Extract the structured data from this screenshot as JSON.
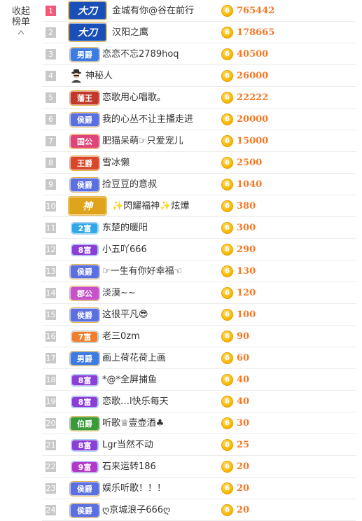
{
  "collapse": {
    "line1": "收起",
    "line2": "榜单"
  },
  "rows": [
    {
      "rank": "1",
      "badge": "大刀",
      "name": "金城有你@谷在前行",
      "score": "765442",
      "bg": "#1a4fb8",
      "kind": "big"
    },
    {
      "rank": "2",
      "badge": "大刀",
      "name": "汉阳之鹰",
      "score": "178665",
      "bg": "#1a4fb8",
      "kind": "big"
    },
    {
      "rank": "3",
      "badge": "男爵",
      "name": "恋恋不忘2789hoq",
      "score": "40500",
      "bg": "#3d7be0",
      "kind": "norm"
    },
    {
      "rank": "4",
      "badge": "",
      "name": "神秘人",
      "score": "26000",
      "bg": "",
      "kind": "spy"
    },
    {
      "rank": "5",
      "badge": "藩王",
      "name": "恋歌用心唱歌。",
      "score": "22222",
      "bg": "#c0392b",
      "kind": "norm"
    },
    {
      "rank": "6",
      "badge": "侯爵",
      "name": "我的心丛不让主播走进",
      "score": "20000",
      "bg": "#5b6fe0",
      "kind": "norm"
    },
    {
      "rank": "7",
      "badge": "国公",
      "name": "肥猫呆萌☞只爱宠儿",
      "score": "15000",
      "bg": "#e0457a",
      "kind": "norm"
    },
    {
      "rank": "8",
      "badge": "王爵",
      "name": "雪冰懒",
      "score": "2500",
      "bg": "#d9462b",
      "kind": "norm"
    },
    {
      "rank": "9",
      "badge": "侯爵",
      "name": "捡豆豆的意叔",
      "score": "1040",
      "bg": "#5b6fe0",
      "kind": "norm"
    },
    {
      "rank": "10",
      "badge": "神",
      "name": "✨閃耀福神✨炫燁",
      "score": "380",
      "bg": "#e0a41c",
      "kind": "big"
    },
    {
      "rank": "11",
      "badge": "2富",
      "name": "东楚的暖阳",
      "score": "300",
      "bg": "#33a6e6",
      "kind": "sm"
    },
    {
      "rank": "12",
      "badge": "8富",
      "name": "小五吖666",
      "score": "290",
      "bg": "#8a3fd6",
      "kind": "sm"
    },
    {
      "rank": "13",
      "badge": "侯爵",
      "name": "☞一生有你好幸福☜",
      "score": "130",
      "bg": "#5b6fe0",
      "kind": "norm"
    },
    {
      "rank": "14",
      "badge": "郡公",
      "name": "淡漠~~",
      "score": "120",
      "bg": "#c552c9",
      "kind": "norm"
    },
    {
      "rank": "15",
      "badge": "侯爵",
      "name": "这很平凡😎",
      "score": "100",
      "bg": "#5b6fe0",
      "kind": "norm"
    },
    {
      "rank": "16",
      "badge": "7富",
      "name": "老三0zm",
      "score": "90",
      "bg": "#ef7d2b",
      "kind": "sm"
    },
    {
      "rank": "17",
      "badge": "男爵",
      "name": "画上荷花荷上画",
      "score": "60",
      "bg": "#3d7be0",
      "kind": "norm"
    },
    {
      "rank": "18",
      "badge": "8富",
      "name": "*@*全屏捕鱼",
      "score": "40",
      "bg": "#8a3fd6",
      "kind": "sm"
    },
    {
      "rank": "19",
      "badge": "8富",
      "name": "恋歌…l快乐每天",
      "score": "40",
      "bg": "#8a3fd6",
      "kind": "sm"
    },
    {
      "rank": "20",
      "badge": "伯爵",
      "name": "听歌♕壹壶酒♣",
      "score": "30",
      "bg": "#3a9a3a",
      "kind": "norm"
    },
    {
      "rank": "21",
      "badge": "8富",
      "name": "Lgr当然不动",
      "score": "25",
      "bg": "#8a3fd6",
      "kind": "sm"
    },
    {
      "rank": "22",
      "badge": "9富",
      "name": "石来运转186",
      "score": "20",
      "bg": "#b238c8",
      "kind": "sm"
    },
    {
      "rank": "23",
      "badge": "侯爵",
      "name": "娱乐听歌！！！",
      "score": "20",
      "bg": "#5b6fe0",
      "kind": "norm"
    },
    {
      "rank": "24",
      "badge": "侯爵",
      "name": "ღ京城浪子666ღ",
      "score": "20",
      "bg": "#5b6fe0",
      "kind": "norm"
    }
  ],
  "coin_glyph": "6",
  "colors": {
    "top_rank": "#f4577a",
    "rank": "#c8c8c8",
    "score": "#f27a2a",
    "coin": "#f6b800"
  }
}
